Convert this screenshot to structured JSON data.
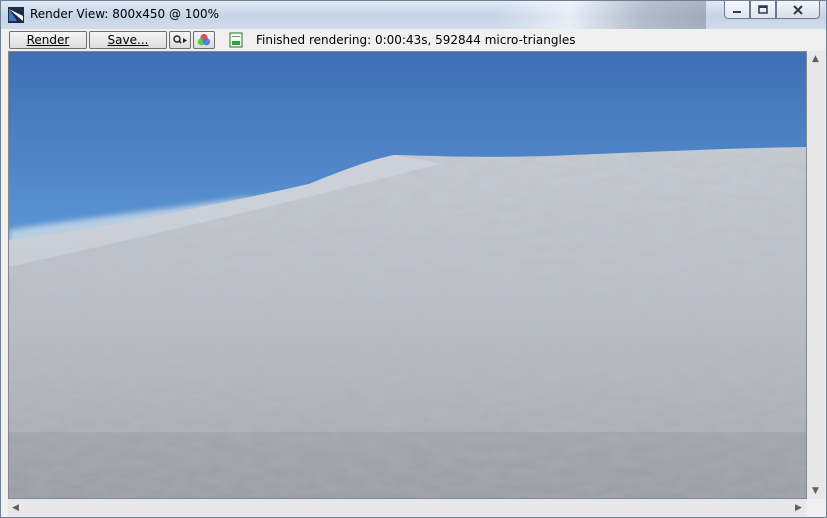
{
  "window": {
    "title": "Render View: 800x450 @ 100%"
  },
  "toolbar": {
    "render_label": "Render",
    "save_label": "Save...",
    "status": "Finished rendering:  0:00:43s, 592844 micro-triangles"
  },
  "icons": {
    "app": "app-logo-icon",
    "zoom": "magnifier-arrow-icon",
    "color": "color-wheel-icon",
    "page": "document-icon"
  }
}
